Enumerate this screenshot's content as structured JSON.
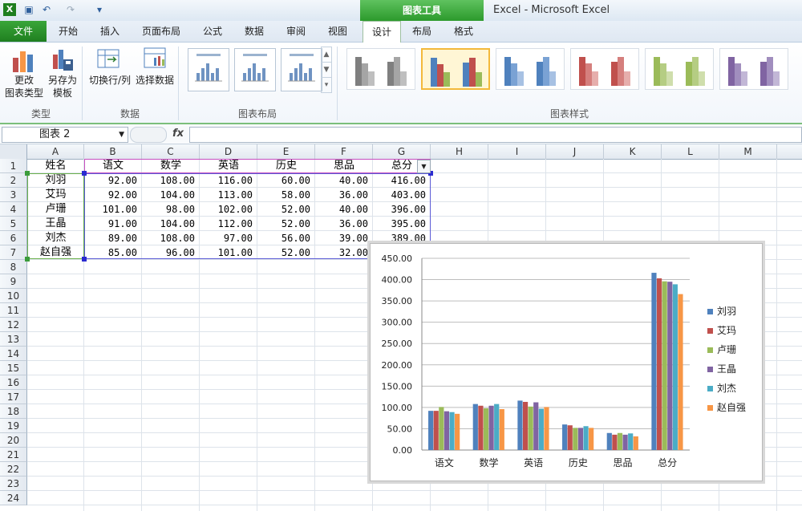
{
  "app": {
    "title": "Excel  -  Microsoft Excel",
    "contextual_tab_group": "图表工具"
  },
  "tabs": {
    "file": "文件",
    "items": [
      "开始",
      "插入",
      "页面布局",
      "公式",
      "数据",
      "审阅",
      "视图",
      "设计",
      "布局",
      "格式"
    ],
    "active": "设计"
  },
  "ribbon": {
    "type_group": {
      "label": "类型",
      "change_type": "更改\n图表类型",
      "save_template": "另存为\n模板"
    },
    "data_group": {
      "label": "数据",
      "switch_row_col": "切换行/列",
      "select_data": "选择数据"
    },
    "layout_group": {
      "label": "图表布局"
    },
    "styles_group": {
      "label": "图表样式"
    }
  },
  "formula_bar": {
    "name_box": "图表 2",
    "fx": "fx",
    "value": ""
  },
  "sheet": {
    "columns": [
      "A",
      "B",
      "C",
      "D",
      "E",
      "F",
      "G",
      "H",
      "I",
      "J",
      "K",
      "L",
      "M"
    ],
    "rows": [
      "1",
      "2",
      "3",
      "4",
      "5",
      "6",
      "7",
      "8",
      "9",
      "10",
      "11",
      "12",
      "13",
      "14",
      "15",
      "16",
      "17",
      "18",
      "19",
      "20",
      "21",
      "22",
      "23",
      "24"
    ],
    "header": [
      "姓名",
      "语文",
      "数学",
      "英语",
      "历史",
      "思品",
      "总分"
    ],
    "data": [
      [
        "刘羽",
        "92.00",
        "108.00",
        "116.00",
        "60.00",
        "40.00",
        "416.00"
      ],
      [
        "艾玛",
        "92.00",
        "104.00",
        "113.00",
        "58.00",
        "36.00",
        "403.00"
      ],
      [
        "卢珊",
        "101.00",
        "98.00",
        "102.00",
        "52.00",
        "40.00",
        "396.00"
      ],
      [
        "王晶",
        "91.00",
        "104.00",
        "112.00",
        "52.00",
        "36.00",
        "395.00"
      ],
      [
        "刘杰",
        "89.00",
        "108.00",
        "97.00",
        "56.00",
        "39.00",
        "389.00"
      ],
      [
        "赵自强",
        "85.00",
        "96.00",
        "101.00",
        "52.00",
        "32.00",
        ""
      ]
    ]
  },
  "chart_data": {
    "type": "bar",
    "categories": [
      "语文",
      "数学",
      "英语",
      "历史",
      "思品",
      "总分"
    ],
    "series": [
      {
        "name": "刘羽",
        "values": [
          92,
          108,
          116,
          60,
          40,
          416
        ],
        "color": "#4f81bd"
      },
      {
        "name": "艾玛",
        "values": [
          92,
          104,
          113,
          58,
          36,
          403
        ],
        "color": "#c0504d"
      },
      {
        "name": "卢珊",
        "values": [
          101,
          98,
          102,
          52,
          40,
          396
        ],
        "color": "#9bbb59"
      },
      {
        "name": "王晶",
        "values": [
          91,
          104,
          112,
          52,
          36,
          395
        ],
        "color": "#8064a2"
      },
      {
        "name": "刘杰",
        "values": [
          89,
          108,
          97,
          56,
          39,
          389
        ],
        "color": "#4bacc6"
      },
      {
        "name": "赵自强",
        "values": [
          85,
          96,
          101,
          52,
          32,
          366
        ],
        "color": "#f79646"
      }
    ],
    "yticks": [
      "0.00",
      "50.00",
      "100.00",
      "150.00",
      "200.00",
      "250.00",
      "300.00",
      "350.00",
      "400.00",
      "450.00"
    ],
    "ylim": [
      0,
      450
    ],
    "grid": true,
    "legend": "right"
  },
  "style_swatches": [
    [
      "#7f7f7f",
      "#a5a5a5",
      "#bfbfbf"
    ],
    [
      "#4f81bd",
      "#c0504d",
      "#9bbb59"
    ],
    [
      "#4f81bd",
      "#7aa2d4",
      "#a7c1e3"
    ],
    [
      "#c0504d",
      "#d57f7d",
      "#e6aeac"
    ],
    [
      "#9bbb59",
      "#b5cd83",
      "#cfdeac"
    ],
    [
      "#8064a2",
      "#a18ebe",
      "#c2b7d6"
    ]
  ]
}
